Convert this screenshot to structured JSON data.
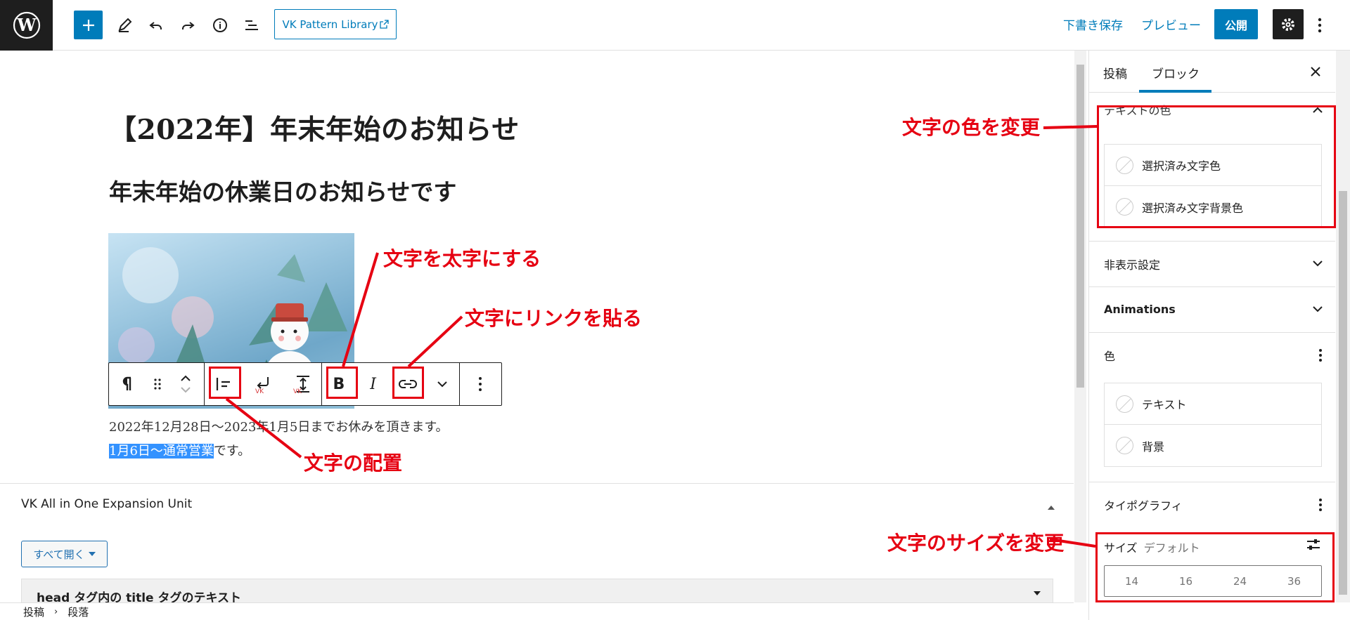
{
  "toolbar": {
    "vk_pattern_label": "VK Pattern Library",
    "save_draft": "下書き保存",
    "preview": "プレビュー",
    "publish": "公開"
  },
  "editor": {
    "post_title": "【2022年】年末年始のお知らせ",
    "heading": "年末年始の休業日のお知らせです",
    "para_line1": "2022年12月28日～2023年1月5日までお休みを頂きます。",
    "para_line2_selected": "1月6日～通常営業",
    "para_line2_rest": "です。"
  },
  "annotations": {
    "bold": "文字を太字にする",
    "link": "文字にリンクを貼る",
    "align": "文字の配置",
    "text_color": "文字の色を変更",
    "text_size": "文字のサイズを変更"
  },
  "vk_panel": {
    "title": "VK All in One Expansion Unit",
    "open_all": "すべて開く",
    "head_title_label": "head タグ内の title タグのテキスト"
  },
  "breadcrumb": {
    "item1": "投稿",
    "item2": "段落"
  },
  "sidebar": {
    "tab_post": "投稿",
    "tab_block": "ブロック",
    "text_color_panel": "テキストの色",
    "selected_text_color": "選択済み文字色",
    "selected_bg_color": "選択済み文字背景色",
    "hide_settings": "非表示設定",
    "animations": "Animations",
    "color_panel": "色",
    "color_text": "テキスト",
    "color_bg": "背景",
    "typography": "タイポグラフィ",
    "size_label": "サイズ",
    "size_value": "デフォルト",
    "size_options": [
      "14",
      "16",
      "24",
      "36"
    ]
  },
  "colors": {
    "accent": "#007cba",
    "annotation_red": "#e60012",
    "selection": "#3392ff"
  }
}
